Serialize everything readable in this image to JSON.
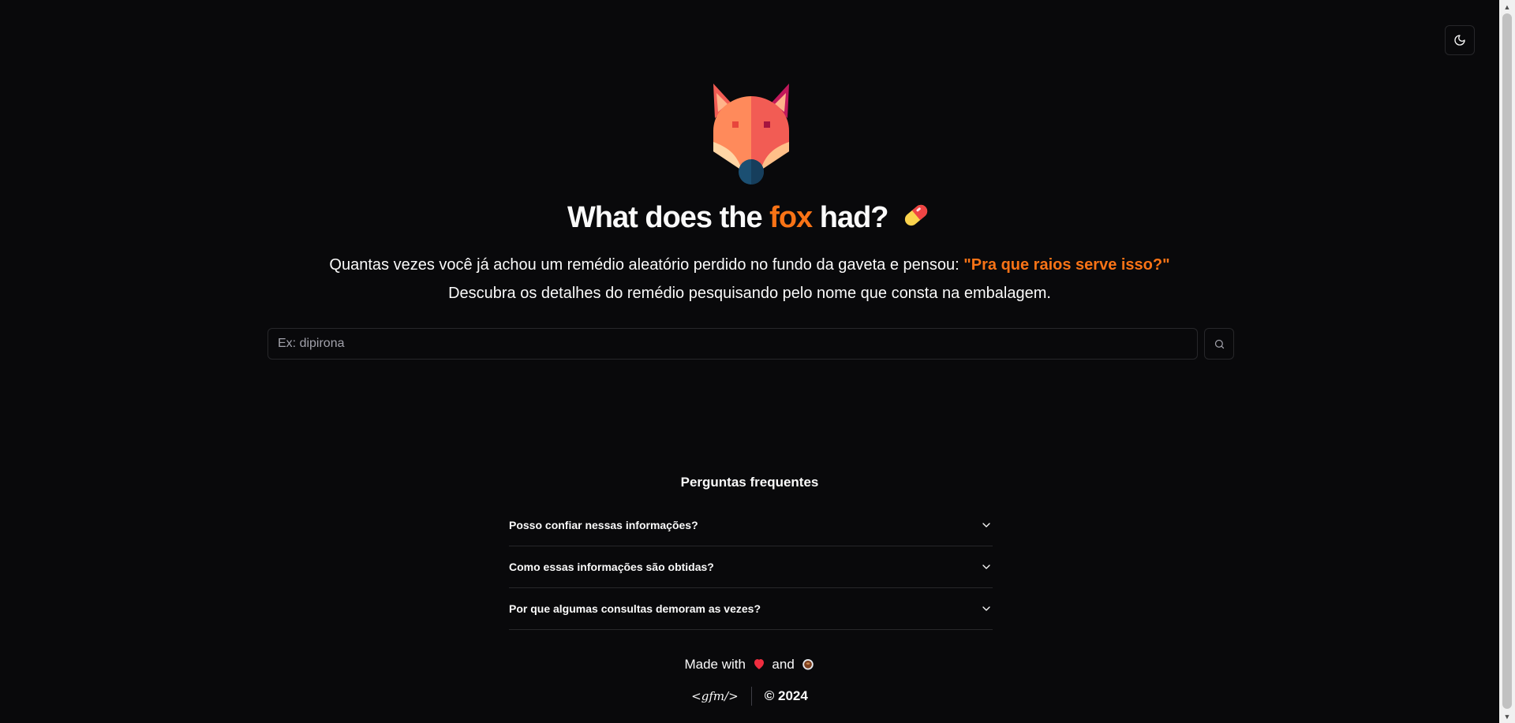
{
  "header": {
    "theme_toggle_icon": "moon-icon"
  },
  "hero": {
    "logo_icon": "fox-logo-icon",
    "title_before": "What does the ",
    "title_accent": "fox",
    "title_after": " had?",
    "title_emoji": "pill-icon",
    "subtitle_line1": "Quantas vezes você já achou um remédio aleatório perdido no fundo da gaveta e pensou: ",
    "subtitle_quote": "\"Pra que raios serve isso?\"",
    "subtitle_line2": "Descubra os detalhes do remédio pesquisando pelo nome que consta na embalagem.",
    "accent_color": "#f97316"
  },
  "search": {
    "placeholder": "Ex: dipirona",
    "value": "",
    "button_icon": "search-icon"
  },
  "faq": {
    "title": "Perguntas frequentes",
    "items": [
      {
        "question": "Posso confiar nessas informações?"
      },
      {
        "question": "Como essas informações são obtidas?"
      },
      {
        "question": "Por que algumas consultas demoram as vezes?"
      }
    ]
  },
  "footer": {
    "made_with_prefix": "Made with",
    "made_with_and": "and",
    "heart_icon": "heart-icon",
    "coffee_icon": "coffee-icon",
    "brand": "<gfm/>",
    "copyright": "© 2024"
  }
}
